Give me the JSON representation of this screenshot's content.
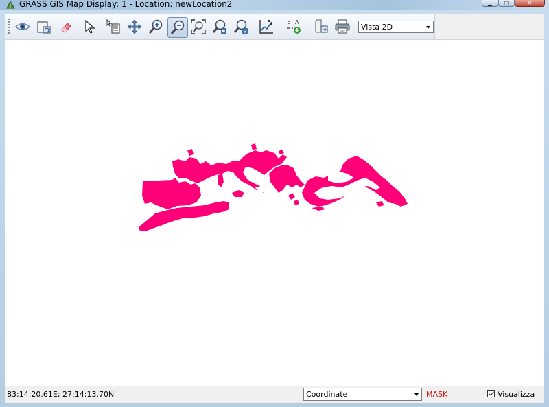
{
  "window": {
    "title": "GRASS GIS Map Display: 1  - Location: newLocation2"
  },
  "toolbar": {
    "tools": [
      {
        "name": "display-map-icon",
        "label": "Display map"
      },
      {
        "name": "render-map-icon",
        "label": "Render map"
      },
      {
        "name": "erase-display-icon",
        "label": "Erase display"
      },
      {
        "name": "pointer-icon",
        "label": "Pointer"
      },
      {
        "name": "query-icon",
        "label": "Query"
      },
      {
        "name": "pan-icon",
        "label": "Pan"
      },
      {
        "name": "zoom-in-icon",
        "label": "Zoom in"
      },
      {
        "name": "zoom-out-icon",
        "label": "Zoom out"
      },
      {
        "name": "zoom-extent-icon",
        "label": "Zoom to extent"
      },
      {
        "name": "zoom-back-icon",
        "label": "Zoom back"
      },
      {
        "name": "zoom-menu-icon",
        "label": "Zoom options"
      },
      {
        "name": "analyze-icon",
        "label": "Analyze"
      },
      {
        "name": "overlay-icon",
        "label": "Add overlay"
      },
      {
        "name": "save-image-icon",
        "label": "Save image"
      },
      {
        "name": "print-icon",
        "label": "Print"
      }
    ],
    "active_tool": "zoom-out-icon",
    "view_mode": "Vista 2D"
  },
  "map": {
    "fill_color": "#ff0078"
  },
  "statusbar": {
    "coordinates": "83:14:20.61E; 27:14:13.70N",
    "mode_select": "Coordinate",
    "mask_label": "MASK",
    "mask_color": "#d11010",
    "render_label": "Visualizza",
    "render_checked": true
  }
}
